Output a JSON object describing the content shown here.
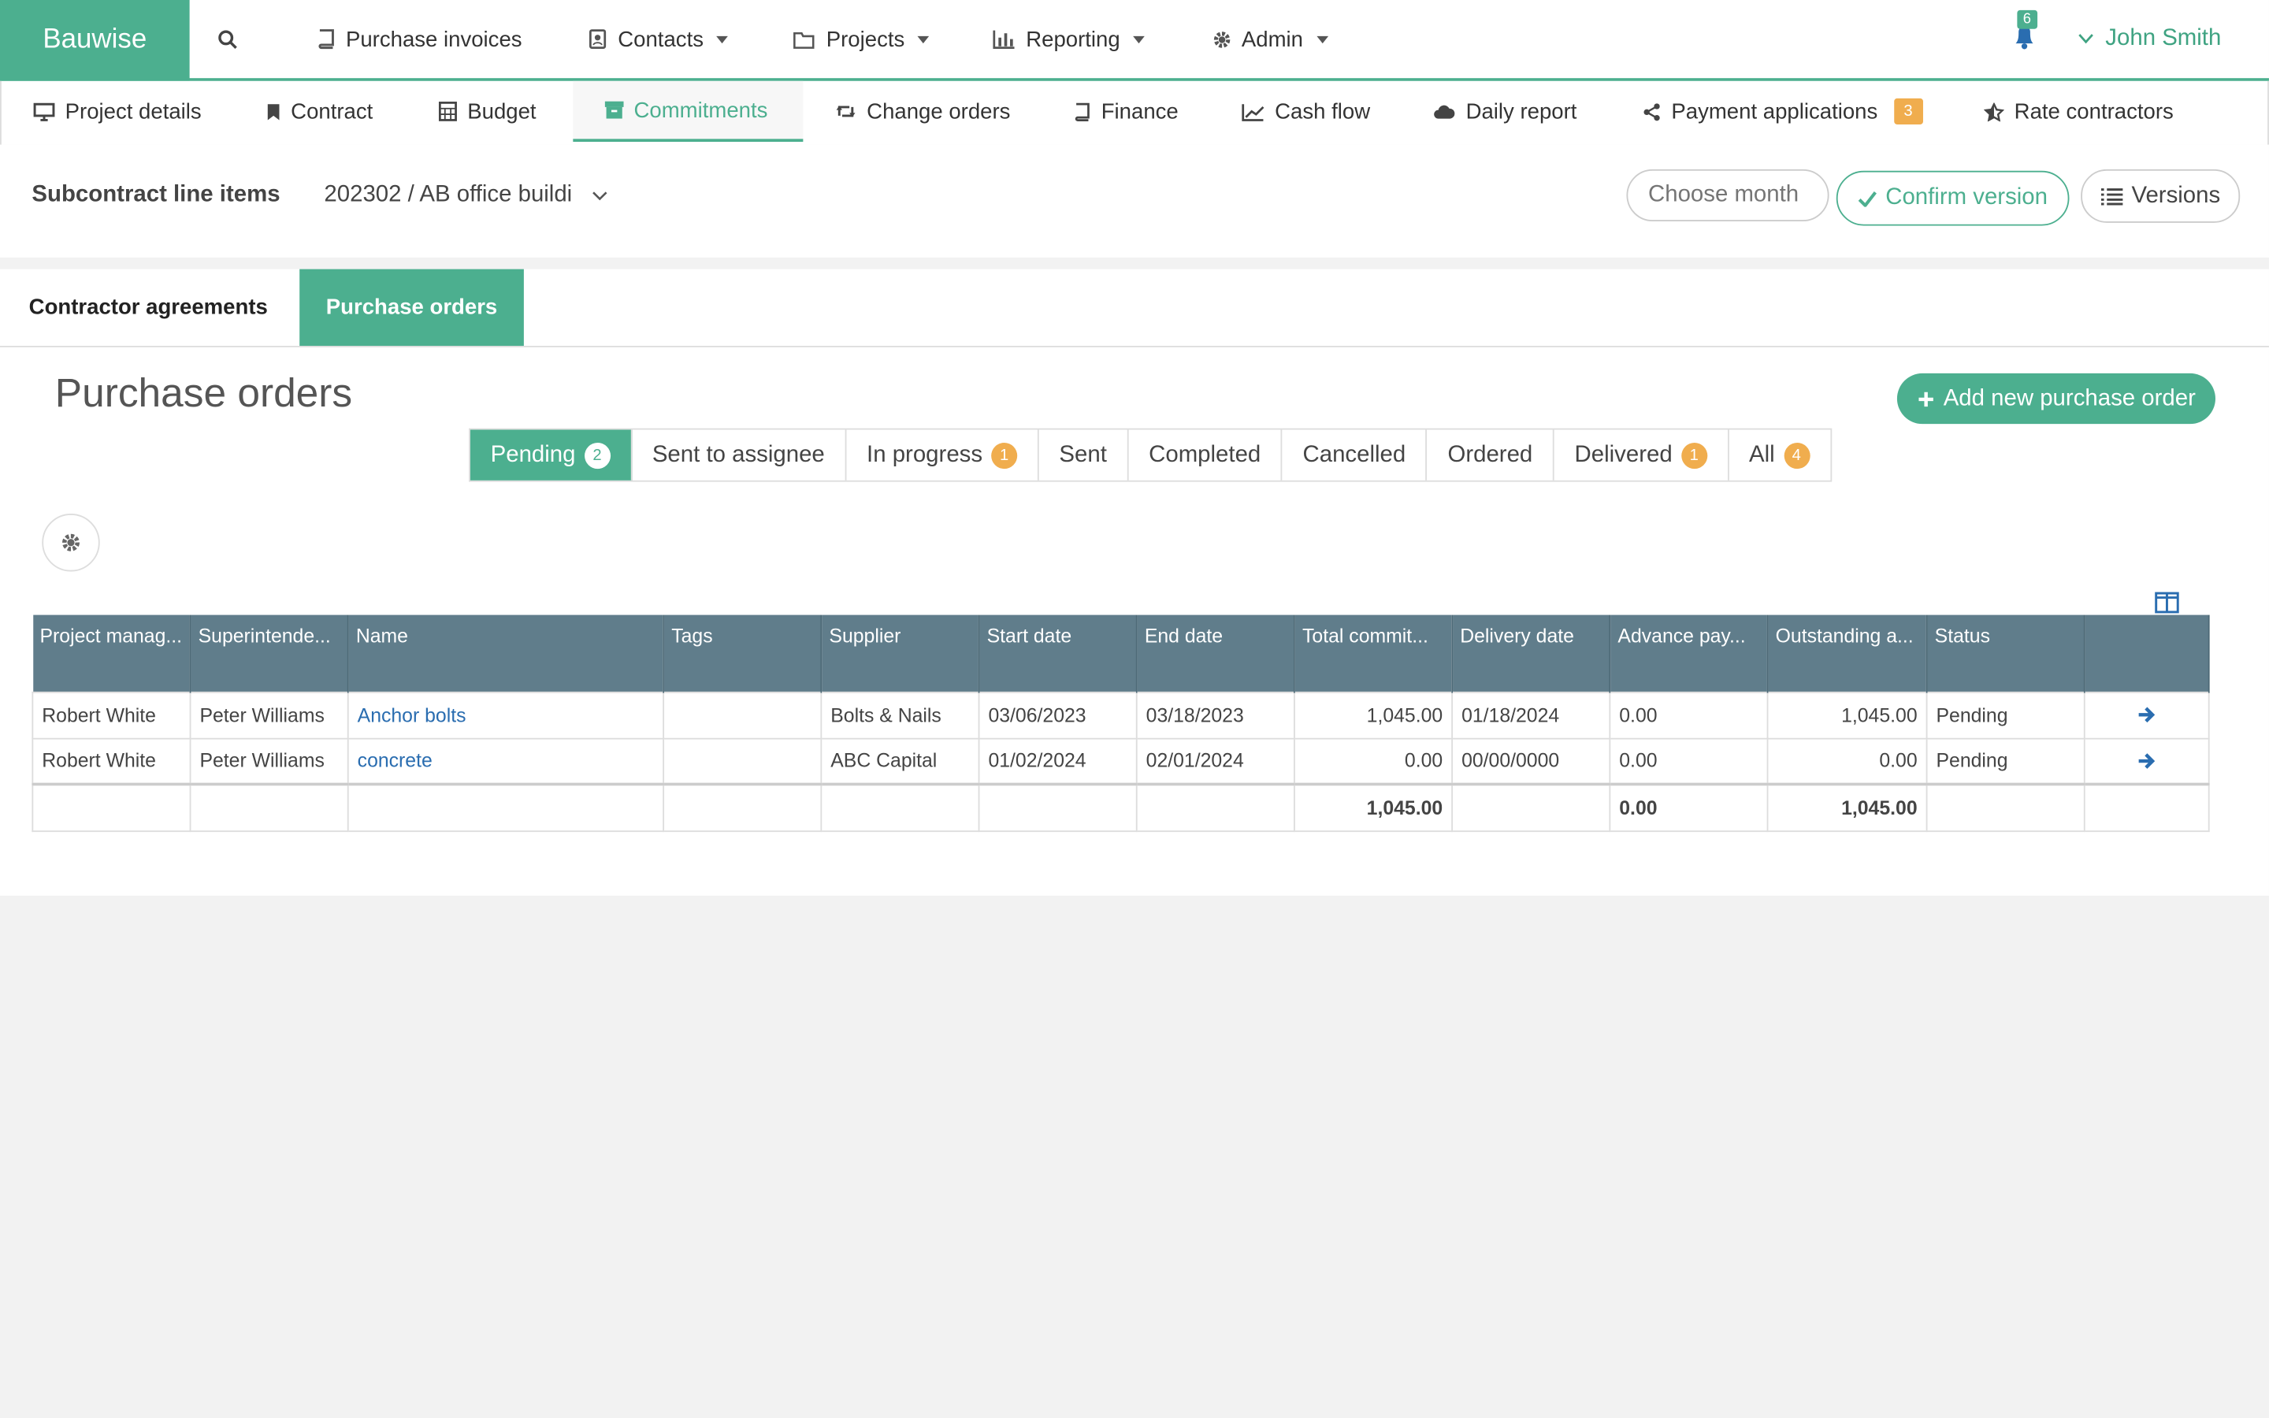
{
  "topbar": {
    "brand": "Bauwise",
    "nav": [
      {
        "label": "Purchase invoices"
      },
      {
        "label": "Contacts"
      },
      {
        "label": "Projects"
      },
      {
        "label": "Reporting"
      },
      {
        "label": "Admin"
      }
    ],
    "notifications_count": "6",
    "user_name": "John Smith"
  },
  "subnav": {
    "items": [
      {
        "label": "Project details"
      },
      {
        "label": "Contract"
      },
      {
        "label": "Budget"
      },
      {
        "label": "Commitments"
      },
      {
        "label": "Change orders"
      },
      {
        "label": "Finance"
      },
      {
        "label": "Cash flow"
      },
      {
        "label": "Daily report"
      },
      {
        "label": "Payment applications",
        "badge": "3"
      },
      {
        "label": "Rate contractors"
      }
    ],
    "active": "Commitments"
  },
  "header": {
    "title": "Subcontract line items",
    "project": "202302 / AB office buildi",
    "month_placeholder": "Choose month",
    "confirm_label": "Confirm version",
    "versions_label": "Versions"
  },
  "tabs": [
    {
      "label": "Contractor agreements"
    },
    {
      "label": "Purchase orders"
    }
  ],
  "page": {
    "title": "Purchase orders",
    "add_button": "Add new purchase order"
  },
  "filters": [
    {
      "label": "Pending",
      "count": "2"
    },
    {
      "label": "Sent to assignee"
    },
    {
      "label": "In progress",
      "count": "1"
    },
    {
      "label": "Sent"
    },
    {
      "label": "Completed"
    },
    {
      "label": "Cancelled"
    },
    {
      "label": "Ordered"
    },
    {
      "label": "Delivered",
      "count": "1"
    },
    {
      "label": "All",
      "count": "4"
    }
  ],
  "table": {
    "columns": [
      "Project manag...",
      "Superintende...",
      "Name",
      "Tags",
      "Supplier",
      "Start date",
      "End date",
      "Total commit...",
      "Delivery date",
      "Advance pay...",
      "Outstanding a...",
      "Status",
      ""
    ],
    "rows": [
      [
        "Robert White",
        "Peter Williams",
        "Anchor bolts",
        "",
        "Bolts & Nails",
        "03/06/2023",
        "03/18/2023",
        "1,045.00",
        "01/18/2024",
        "0.00",
        "1,045.00",
        "Pending"
      ],
      [
        "Robert White",
        "Peter Williams",
        "concrete",
        "",
        "ABC Capital",
        "01/02/2024",
        "02/01/2024",
        "0.00",
        "00/00/0000",
        "0.00",
        "0.00",
        "Pending"
      ]
    ],
    "totals": {
      "total_commit": "1,045.00",
      "advance": "0.00",
      "outstanding": "1,045.00"
    }
  },
  "colors": {
    "brand": "#4caf8f",
    "header": "#607d8b",
    "badge": "#f0ad4e",
    "link": "#2a6db0"
  }
}
